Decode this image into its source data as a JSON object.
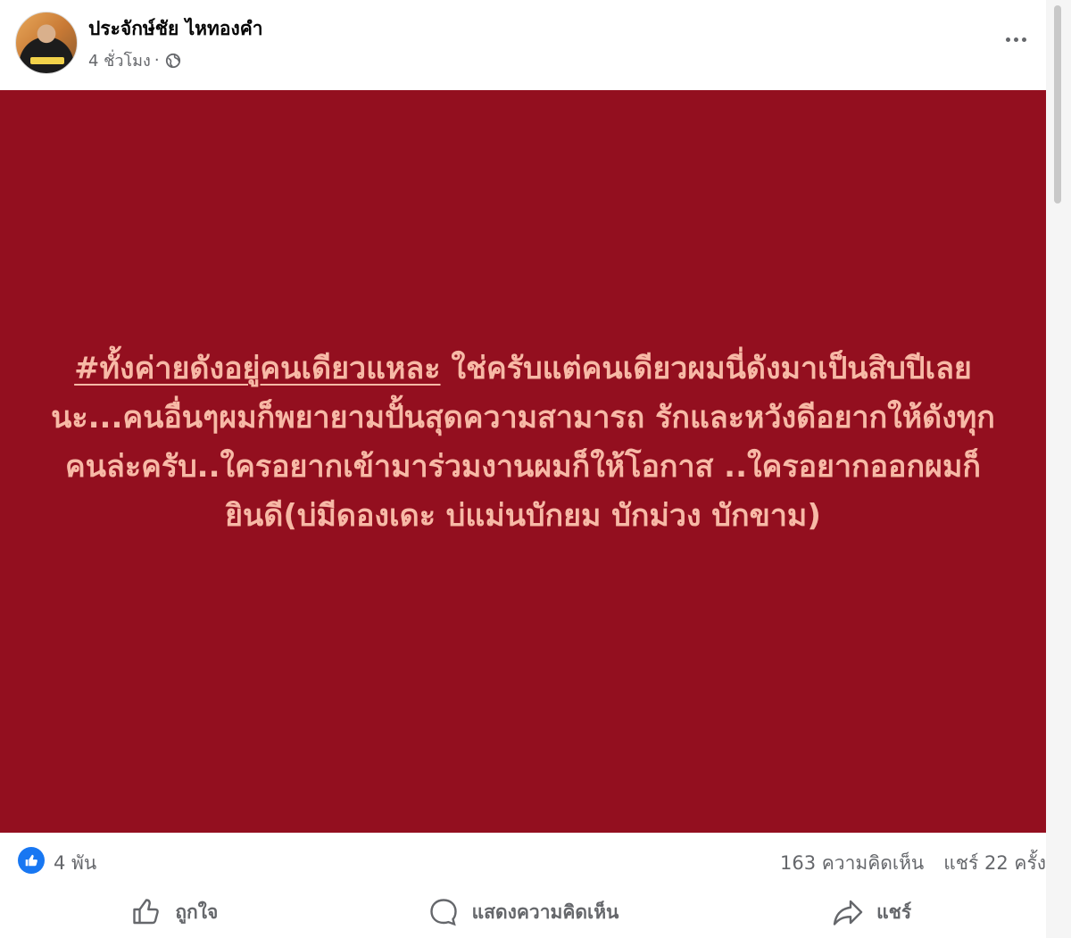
{
  "post": {
    "author_name": "ประจักษ์ชัย ไหทองคำ",
    "time": "4 ชั่วโมง",
    "separator": "·",
    "privacy_icon": "globe-icon",
    "more_icon": "more-horizontal-icon"
  },
  "content": {
    "hashtag": "#ทั้งค่ายดังอยู่คนเดียวแหละ",
    "body": " ใช่ครับแต่คนเดียวผมนี่ดังมาเป็นสิบปีเลยนะ...คนอื่นๆผมก็พยายามปั้นสุดความสามารถ รักและหวังดีอยากให้ดังทุกคนล่ะครับ..ใครอยากเข้ามาร่วมงานผมก็ให้โอกาส ..ใครอยากออกผมก็ยินดี(บ่มีดองเดะ บ่แม่นบักยม บักม่วง บักขาม)",
    "background_color": "#930f1f",
    "text_color": "#f7b9a6"
  },
  "stats": {
    "reactions": "4 พัน",
    "comments": "163 ความคิดเห็น",
    "shares": "แชร์ 22 ครั้ง",
    "reaction_icon": "like-icon"
  },
  "actions": {
    "like_label": "ถูกใจ",
    "comment_label": "แสดงความคิดเห็น",
    "share_label": "แชร์"
  }
}
